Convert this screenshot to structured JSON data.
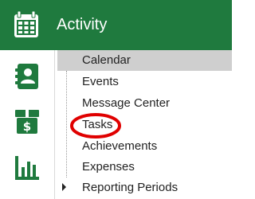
{
  "header": {
    "title": "Activity",
    "icon": "calendar-icon",
    "background": "#1f7a3e"
  },
  "rail": {
    "items": [
      {
        "icon": "contact-book-icon"
      },
      {
        "icon": "money-box-icon"
      },
      {
        "icon": "bar-chart-icon"
      }
    ],
    "icon_color": "#1f7a3e"
  },
  "menu": {
    "items": [
      {
        "label": "Calendar",
        "selected": true
      },
      {
        "label": "Events"
      },
      {
        "label": "Message Center"
      },
      {
        "label": "Tasks",
        "highlighted": true
      },
      {
        "label": "Achievements"
      },
      {
        "label": "Expenses"
      },
      {
        "label": "Reporting Periods",
        "expandable": true
      }
    ],
    "selected_background": "#cfcfcf"
  },
  "annotation": {
    "color": "#e00000"
  }
}
